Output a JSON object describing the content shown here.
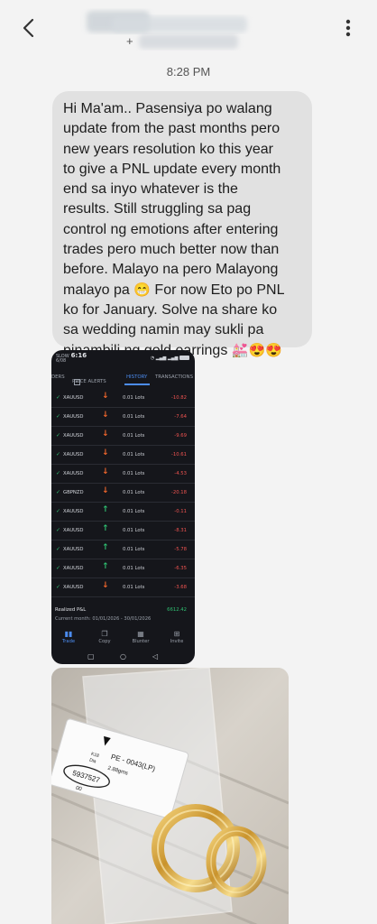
{
  "header": {
    "back_icon": "chevron-left-icon",
    "contact_redacted": true,
    "contact_plus": "+",
    "more_icon": "kebab-menu-icon"
  },
  "conversation": {
    "timestamp": "8:28 PM",
    "message": {
      "lines": [
        "Hi Ma'am.. Pasensiya po walang",
        "update from the past months pero",
        "new years resolution ko this year",
        "to give a PNL update  every month",
        "end sa inyo whatever  is the",
        "results. Still struggling sa pag",
        "control ng emotions after entering",
        "trades pero much better now than",
        "before. Malayo na pero Malayong",
        "malayo pa",
        "For now Eto po PNL",
        "ko for January. Solve na share ko",
        "sa wedding namin may sukli pa",
        "pinambili ng gold earrings"
      ],
      "emoji_grin": "😁",
      "emoji_end": "💒😍😍"
    }
  },
  "trading_screenshot": {
    "status": {
      "time": "6:16",
      "left_small_top": "SLOW",
      "left_small_bottom": "6/08"
    },
    "tabs": [
      {
        "label": "DERS"
      },
      {
        "label": "PRICE ALERTS",
        "badge": "2"
      },
      {
        "label": "HISTORY",
        "active": true
      },
      {
        "label": "TRANSACTIONS"
      }
    ],
    "trades": [
      {
        "symbol": "XAUUSD",
        "direction": "down",
        "lots": "0.01 Lots",
        "pnl": "-10.82"
      },
      {
        "symbol": "XAUUSD",
        "direction": "down",
        "lots": "0.01 Lots",
        "pnl": "-7.64"
      },
      {
        "symbol": "XAUUSD",
        "direction": "down",
        "lots": "0.01 Lots",
        "pnl": "-9.69"
      },
      {
        "symbol": "XAUUSD",
        "direction": "down",
        "lots": "0.01 Lots",
        "pnl": "-10.61"
      },
      {
        "symbol": "XAUUSD",
        "direction": "down",
        "lots": "0.01 Lots",
        "pnl": "-4.53"
      },
      {
        "symbol": "GBPNZD",
        "direction": "down",
        "lots": "0.01 Lots",
        "pnl": "-20.18"
      },
      {
        "symbol": "XAUUSD",
        "direction": "up",
        "lots": "0.01 Lots",
        "pnl": "-0.11"
      },
      {
        "symbol": "XAUUSD",
        "direction": "up",
        "lots": "0.01 Lots",
        "pnl": "-8.31"
      },
      {
        "symbol": "XAUUSD",
        "direction": "up",
        "lots": "0.01 Lots",
        "pnl": "-5.78"
      },
      {
        "symbol": "XAUUSD",
        "direction": "up",
        "lots": "0.01 Lots",
        "pnl": "-6.35"
      },
      {
        "symbol": "XAUUSD",
        "direction": "down",
        "lots": "0.01 Lots",
        "pnl": "-3.68"
      }
    ],
    "realized_label": "Realized P&L",
    "realized_value": "6612.42",
    "period": "Current month: 01/01/2026 - 30/01/2026",
    "bottom_nav": [
      {
        "label": "Trade",
        "icon": "bar-chart-icon",
        "active": true
      },
      {
        "label": "Copy",
        "icon": "copy-icon"
      },
      {
        "label": "Blunter",
        "icon": "grid-icon"
      },
      {
        "label": "Invite",
        "icon": "gift-icon"
      }
    ]
  },
  "photo": {
    "tag_line1": "PE - 0043(LP)",
    "tag_line2": "2.88gms",
    "tag_k": "K18",
    "tag_k2": "Dia",
    "tag_number": "5937527",
    "tag_small": "00"
  },
  "colors": {
    "bubble": "#e1e1e1",
    "app_bg": "#15161b",
    "accent": "#4c8cf0",
    "loss": "#ef5350",
    "gain": "#2fbf71"
  }
}
